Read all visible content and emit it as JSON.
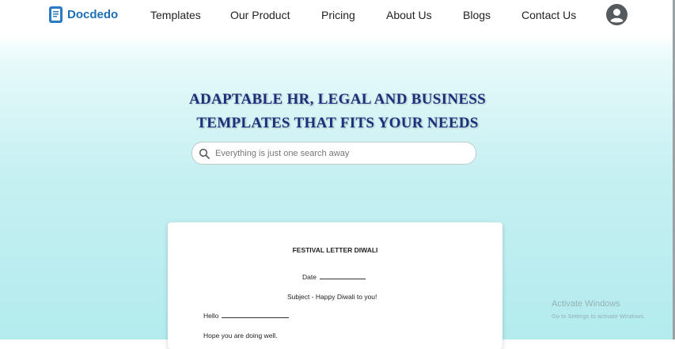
{
  "header": {
    "logo_text": "Docdedo",
    "nav": [
      "Templates",
      "Our Product",
      "Pricing",
      "About Us",
      "Blogs",
      "Contact Us"
    ]
  },
  "hero": {
    "title_line1": "ADAPTABLE HR, LEGAL AND BUSINESS",
    "title_line2": "TEMPLATES THAT FITS YOUR NEEDS"
  },
  "search": {
    "placeholder": "Everything is just one search away",
    "value": ""
  },
  "document_preview": {
    "title": "FESTIVAL LETTER DIWALI",
    "date_label": "Date",
    "subject": "Subject - Happy Diwali to you!",
    "greeting": "Hello",
    "body_first_line": "Hope you are doing well."
  },
  "watermark": {
    "title": "Activate Windows",
    "subtitle": "Go to Settings to activate Windows."
  },
  "colors": {
    "brand": "#1f6fb8",
    "title": "#1b2f7a",
    "bg_top": "#e6f9fa",
    "bg_bottom": "#b3ebee"
  }
}
